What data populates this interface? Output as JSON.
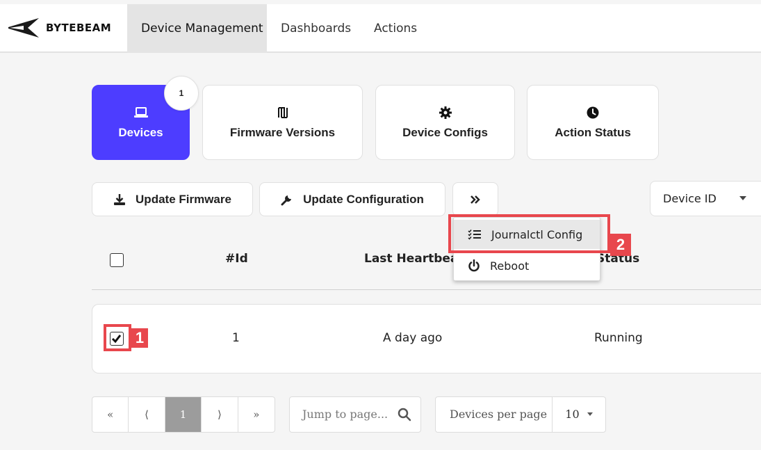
{
  "header": {
    "brand": "BYTEBEAM",
    "tabs": [
      {
        "label": "Device Management",
        "active": true
      },
      {
        "label": "Dashboards",
        "active": false
      },
      {
        "label": "Actions",
        "active": false
      }
    ]
  },
  "cards": [
    {
      "label": "Devices",
      "icon": "laptop-icon",
      "active": true
    },
    {
      "label": "Firmware Versions",
      "icon": "firmware-icon",
      "active": false
    },
    {
      "label": "Device Configs",
      "icon": "gear-icon",
      "active": false
    },
    {
      "label": "Action Status",
      "icon": "clock-icon",
      "active": false
    }
  ],
  "badge": "1",
  "toolbar": {
    "update_firmware": "Update Firmware",
    "update_configuration": "Update Configuration",
    "more_icon": "double-chevron-right-icon",
    "filter_select": "Device ID"
  },
  "menu": {
    "items": [
      {
        "label": "Journalctl Config",
        "icon": "list-check-icon"
      },
      {
        "label": "Reboot",
        "icon": "power-icon"
      }
    ]
  },
  "table": {
    "headers": [
      "#Id",
      "Last Heartbeat",
      "Status"
    ],
    "visible_headers": [
      "#Id",
      "Last Heartbeat",
      "Status"
    ],
    "rows": [
      {
        "id": "1",
        "last_heartbeat": "A day ago",
        "status": "Running",
        "checked": true
      }
    ]
  },
  "annotations": {
    "step1": "1",
    "step2": "2"
  },
  "pagination": {
    "first": "«",
    "prev": "⟨",
    "current": "1",
    "next": "⟩",
    "last": "»",
    "jump_placeholder": "Jump to page...",
    "per_page_label": "Devices per page",
    "per_page_value": "10"
  },
  "colors": {
    "accent": "#4d3dff",
    "annotation": "#e8474d"
  }
}
